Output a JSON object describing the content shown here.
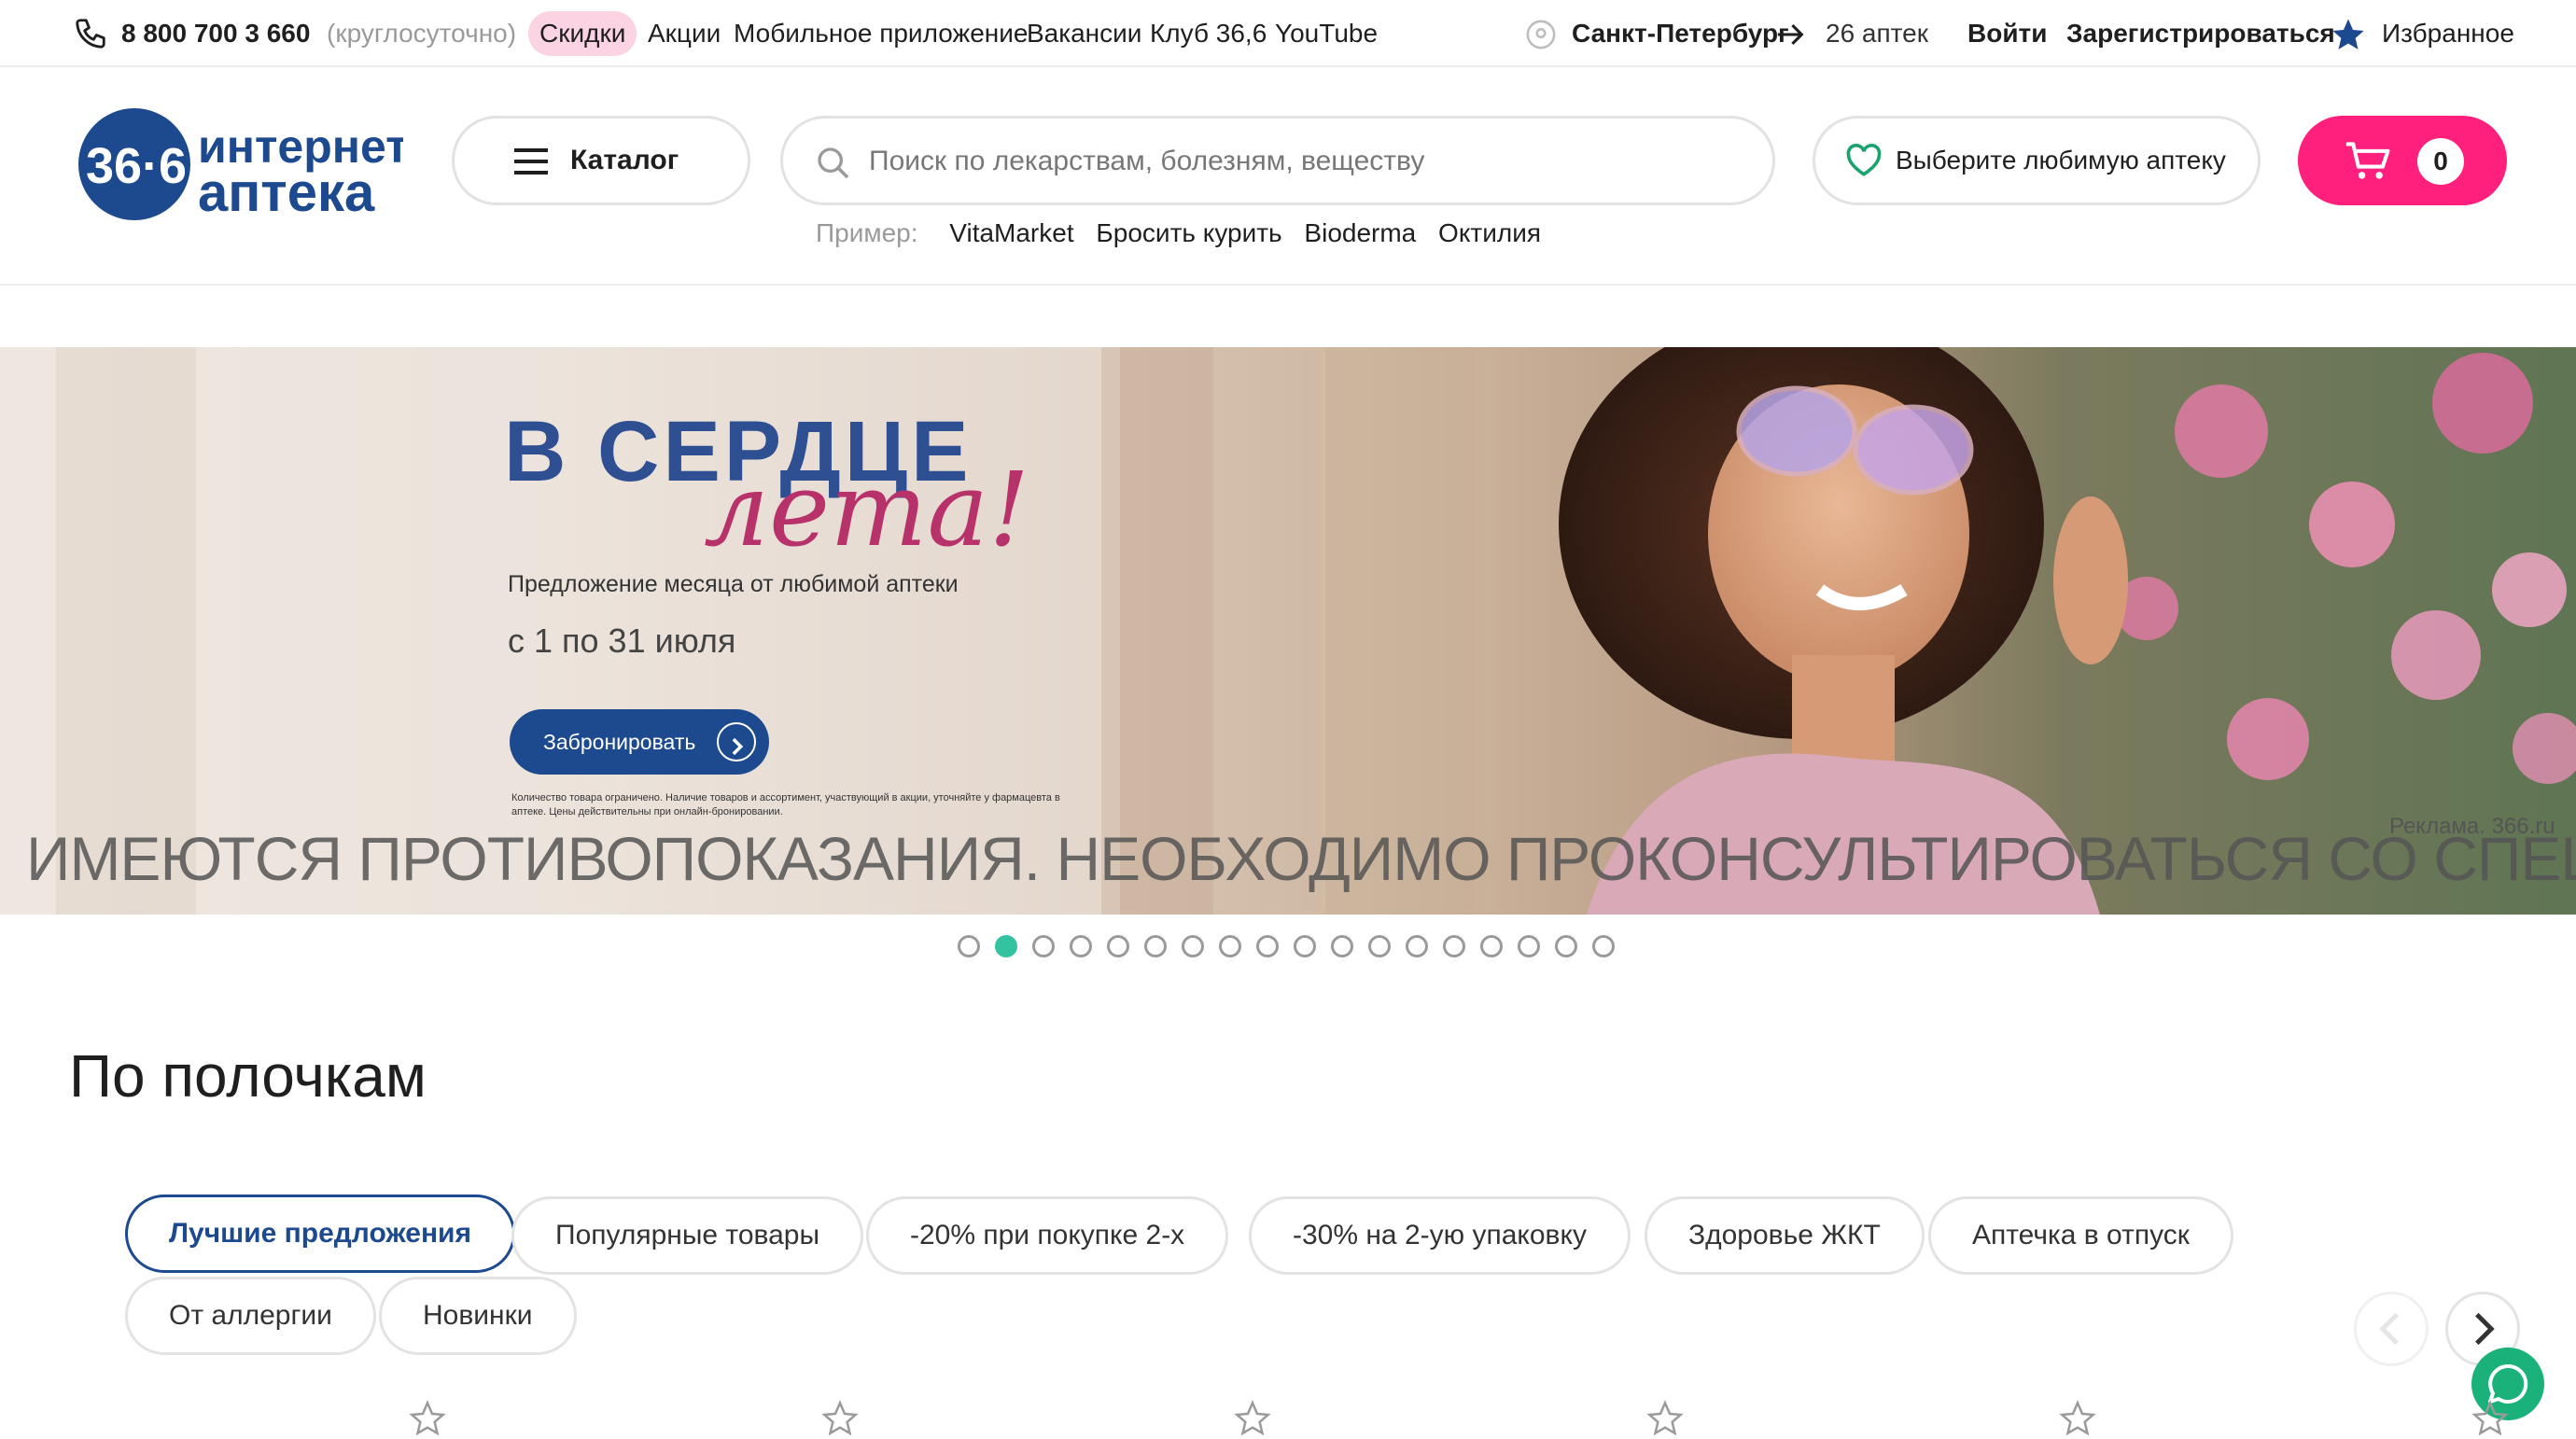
{
  "topbar": {
    "phone": "8 800 700 3 660",
    "phone_note": "(круглосуточно)",
    "links": [
      "Скидки",
      "Акции",
      "Мобильное приложение",
      "Вакансии",
      "Клуб 36,6",
      "YouTube"
    ],
    "city": "Санкт-Петербург",
    "stores": "26 аптек",
    "login": "Войти",
    "register": "Зарегистрироваться",
    "favorites": "Избранное"
  },
  "header": {
    "logo_number": "36·6",
    "logo_line1": "интернет",
    "logo_line2": "аптека",
    "catalog": "Каталог",
    "search_placeholder": "Поиск по лекарствам, болезням, веществу",
    "examples_label": "Пример:",
    "examples": [
      "VitaMarket",
      "Бросить курить",
      "Bioderma",
      "Октилия"
    ],
    "favorite_store": "Выберите любимую аптеку",
    "cart_count": "0"
  },
  "banner": {
    "title_line1": "В СЕРДЦЕ",
    "title_line2": "лета!",
    "offer": "Предложение месяца от любимой аптеки",
    "dates": "с 1 по 31 июля",
    "book_button": "Забронировать",
    "fine_print": "Количество товара ограничено. Наличие товаров и ассортимент, участвующий в акции, уточняйте у фармацевта в аптеке. Цены действительны при онлайн-бронировании.",
    "ad_label": "Реклама. 366.ru",
    "warning": "ИМЕЮТСЯ ПРОТИВОПОКАЗАНИЯ. НЕОБХОДИМО ПРОКОНСУЛЬТИРОВАТЬСЯ СО СПЕЦИАЛИСТОМ",
    "slides_total": 18,
    "active_slide": 2
  },
  "section": {
    "title": "По полочкам",
    "chips": [
      "Лучшие предложения",
      "Популярные товары",
      "-20% при покупке 2-х",
      "-30% на 2-ую упаковку",
      "Здоровье ЖКТ",
      "Аптечка в отпуск",
      "От аллергии",
      "Новинки"
    ],
    "active_chip": "Лучшие предложения"
  },
  "colors": {
    "brand_blue": "#1d4a8f",
    "cart_pink": "#ff1f7c",
    "discount_pill": "#fbd3e2",
    "dot_active": "#33c3a1",
    "chat_green": "#1ab27a",
    "heart_green": "#1aa36f"
  },
  "icons": [
    "phone-icon",
    "location-icon",
    "arrow-right-icon",
    "star-icon",
    "menu-icon",
    "search-icon",
    "heart-icon",
    "cart-icon",
    "chevron-left-icon",
    "chevron-right-icon",
    "chat-icon",
    "star-outline-icon"
  ]
}
